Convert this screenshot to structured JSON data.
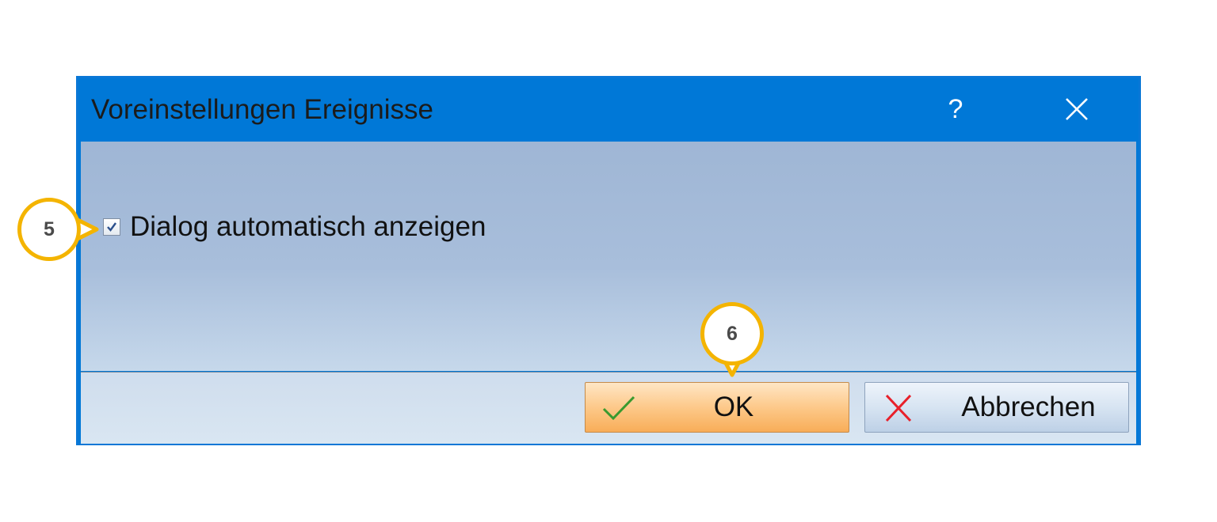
{
  "dialog": {
    "title": "Voreinstellungen Ereignisse",
    "help_label": "?",
    "close_icon": "close-icon"
  },
  "options": {
    "auto_show_label": "Dialog automatisch anzeigen",
    "auto_show_checked": true
  },
  "buttons": {
    "ok_label": "OK",
    "ok_icon": "checkmark-icon",
    "cancel_label": "Abbrechen",
    "cancel_icon": "cross-icon"
  },
  "callouts": [
    {
      "label": "5",
      "target": "auto-show-checkbox"
    },
    {
      "label": "6",
      "target": "ok-button"
    }
  ],
  "colors": {
    "titlebar": "#0078d7",
    "callout_ring": "#f4b400",
    "ok_button": "#f8ad58",
    "check_green": "#3a9a2f",
    "cross_red": "#e8202a"
  }
}
